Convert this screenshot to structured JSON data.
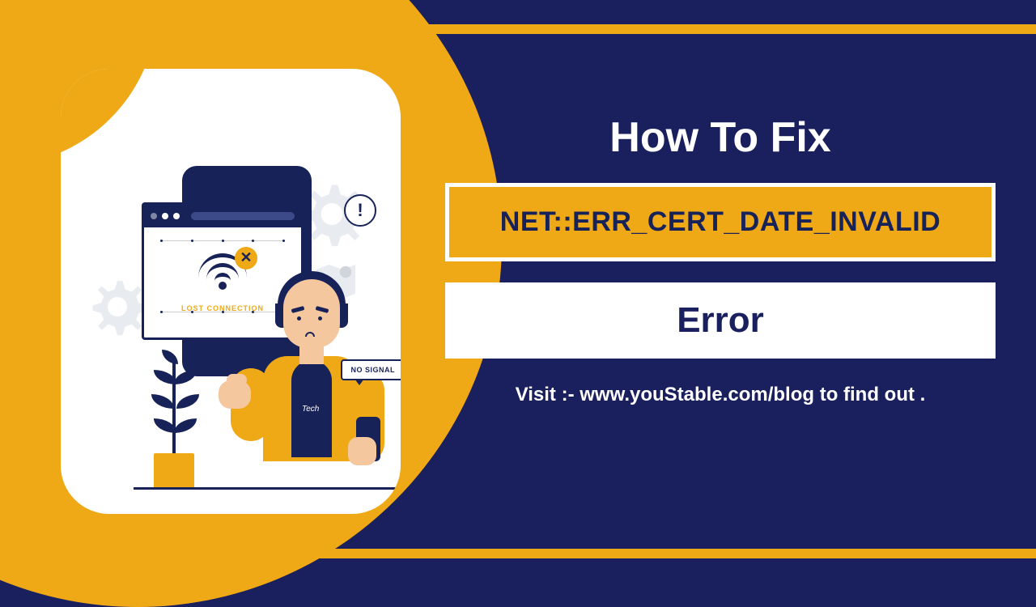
{
  "colors": {
    "primary_bg": "#1a1f5e",
    "accent": "#efa917",
    "white": "#ffffff",
    "skin": "#f4c79f"
  },
  "header": {
    "title": "How To Fix"
  },
  "error": {
    "code": "NET::ERR_CERT_DATE_INVALID",
    "label": "Error"
  },
  "cta": {
    "text": "Visit :- www.youStable.com/blog to find out ."
  },
  "illustration": {
    "lost_connection_label": "LOST CONNECTION",
    "no_signal_label": "NO SIGNAL",
    "exclaim": "!",
    "wifi_badge": "✕",
    "shirt_text": "Tech"
  }
}
